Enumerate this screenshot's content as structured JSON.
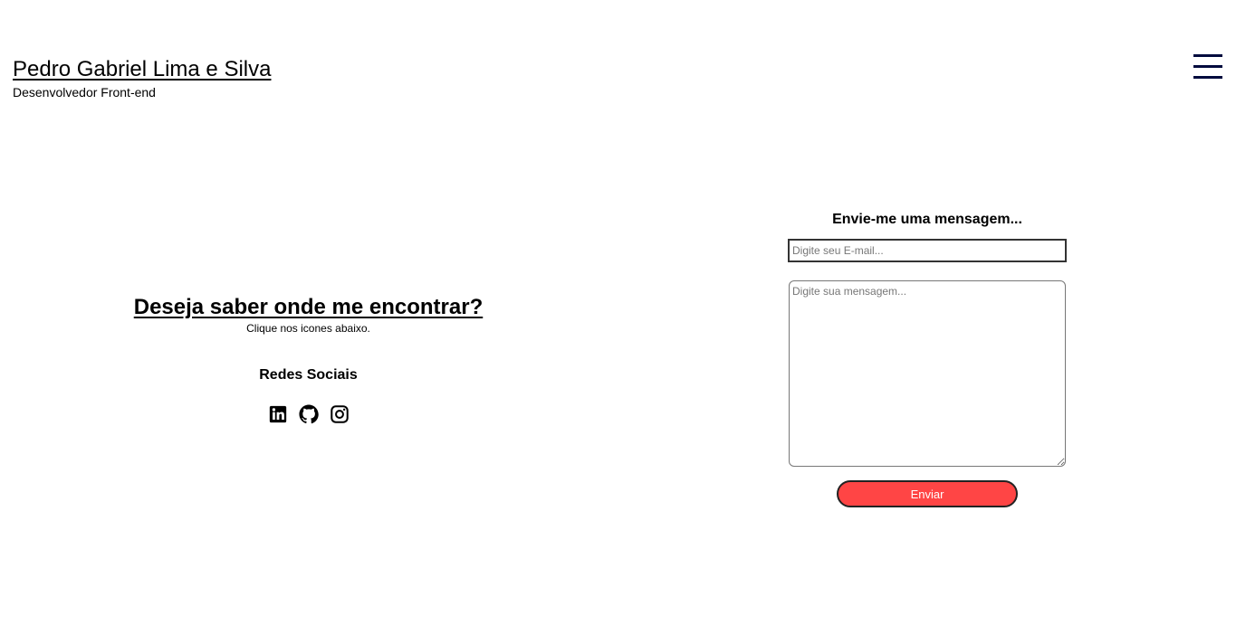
{
  "header": {
    "name": "Pedro Gabriel Lima e Silva",
    "role": "Desenvolvedor Front-end",
    "menu_icon": "hamburger-menu-icon",
    "menu_color": "#000a3d"
  },
  "contact": {
    "title": "Deseja saber onde me encontrar?",
    "subtitle": "Clique nos icones abaixo.",
    "social_title": "Redes Sociais",
    "social_icons": [
      "linkedin-icon",
      "github-icon",
      "instagram-icon"
    ]
  },
  "form": {
    "title": "Envie-me uma mensagem...",
    "email_placeholder": "Digite seu E-mail...",
    "message_placeholder": "Digite sua mensagem...",
    "submit_label": "Enviar",
    "submit_color": "#ff4545"
  }
}
